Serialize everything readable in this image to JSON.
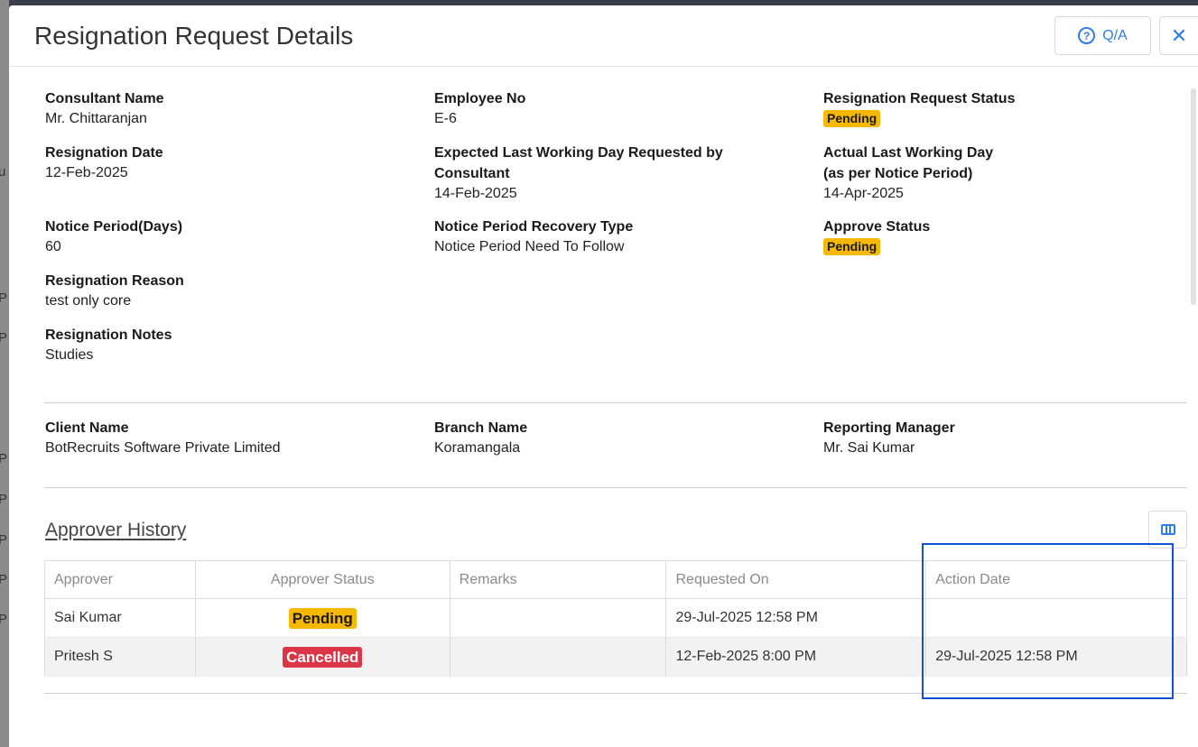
{
  "modal": {
    "title": "Resignation Request Details",
    "qa_label": "Q/A",
    "qa_icon": "question-circle-icon",
    "close_icon": "close-icon",
    "close_glyph": "✕"
  },
  "details": {
    "consultant_name": {
      "label": "Consultant Name",
      "value": "Mr. Chittaranjan"
    },
    "employee_no": {
      "label": "Employee No",
      "value": "E-6"
    },
    "resignation_request_status": {
      "label": "Resignation Request Status",
      "value": "Pending"
    },
    "resignation_date": {
      "label": "Resignation Date",
      "value": "12-Feb-2025"
    },
    "expected_last_working_day": {
      "label": "Expected Last Working Day Requested by Consultant",
      "value": "14-Feb-2025"
    },
    "actual_last_working_day": {
      "label": "Actual Last Working Day",
      "sublabel": "(as per Notice Period)",
      "value": "14-Apr-2025"
    },
    "notice_period_days": {
      "label": "Notice Period(Days)",
      "value": "60"
    },
    "notice_period_recovery_type": {
      "label": "Notice Period Recovery Type",
      "value": "Notice Period Need To Follow"
    },
    "approve_status": {
      "label": "Approve Status",
      "value": "Pending"
    },
    "resignation_reason": {
      "label": "Resignation Reason",
      "value": "test only core"
    },
    "resignation_notes": {
      "label": "Resignation Notes",
      "value": "Studies"
    }
  },
  "client": {
    "client_name": {
      "label": "Client Name",
      "value": "BotRecruits Software Private Limited"
    },
    "branch_name": {
      "label": "Branch Name",
      "value": "Koramangala"
    },
    "reporting_manager": {
      "label": "Reporting Manager",
      "value": "Mr. Sai Kumar"
    }
  },
  "approver_history": {
    "title": "Approver History",
    "columns_icon": "columns-icon",
    "headers": [
      "Approver",
      "Approver Status",
      "Remarks",
      "Requested On",
      "Action Date"
    ],
    "rows": [
      {
        "approver": "Sai Kumar",
        "status": "Pending",
        "remarks": "",
        "requested_on": "29-Jul-2025 12:58 PM",
        "action_date": ""
      },
      {
        "approver": "Pritesh S",
        "status": "Cancelled",
        "remarks": "",
        "requested_on": "12-Feb-2025 8:00 PM",
        "action_date": "29-Jul-2025 12:58 PM"
      }
    ]
  },
  "backdrop": {
    "fragments": [
      "Pr",
      "Pr",
      "Pr",
      "Pr",
      "Pr",
      "Pr",
      "Pr",
      "u"
    ]
  },
  "colors": {
    "accent": "#2f7be8",
    "pending": "#f6b800",
    "cancelled": "#dc3545",
    "highlight": "#1352d4"
  }
}
